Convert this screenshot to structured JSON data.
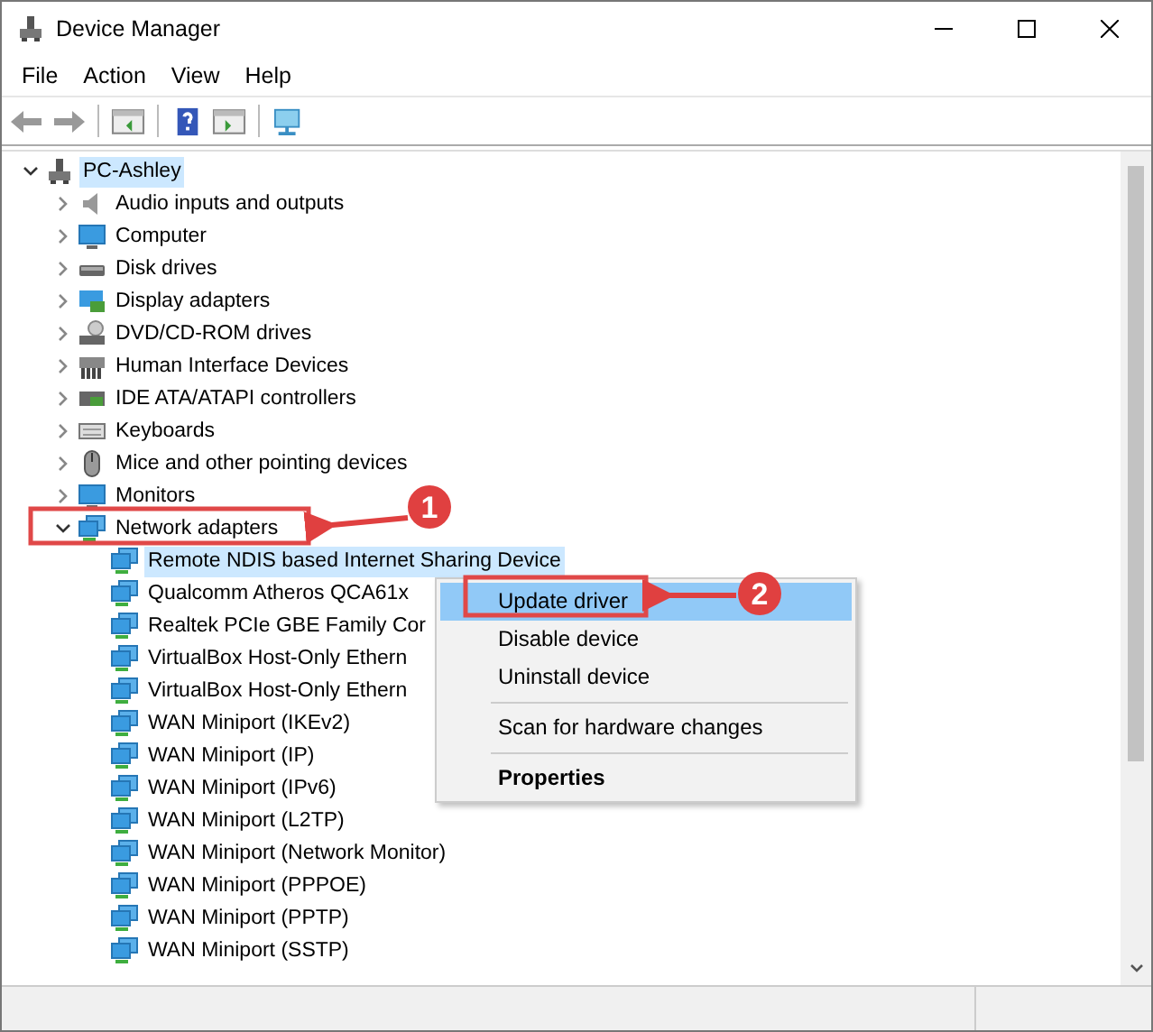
{
  "window": {
    "title": "Device Manager"
  },
  "menu_bar": [
    "File",
    "Action",
    "View",
    "Help"
  ],
  "tree": {
    "label": "PC-Ashley",
    "kind": "computer",
    "expanded": true,
    "selected": true,
    "children": [
      {
        "label": "Audio inputs and outputs",
        "kind": "audio",
        "expanded": false,
        "selected": false
      },
      {
        "label": "Computer",
        "kind": "monitor",
        "expanded": false,
        "selected": false
      },
      {
        "label": "Disk drives",
        "kind": "disk",
        "expanded": false,
        "selected": false
      },
      {
        "label": "Display adapters",
        "kind": "display",
        "expanded": false,
        "selected": false
      },
      {
        "label": "DVD/CD-ROM drives",
        "kind": "dvd",
        "expanded": false,
        "selected": false
      },
      {
        "label": "Human Interface Devices",
        "kind": "hid",
        "expanded": false,
        "selected": false
      },
      {
        "label": "IDE ATA/ATAPI controllers",
        "kind": "ide",
        "expanded": false,
        "selected": false
      },
      {
        "label": "Keyboards",
        "kind": "keyboard",
        "expanded": false,
        "selected": false
      },
      {
        "label": "Mice and other pointing devices",
        "kind": "mouse",
        "expanded": false,
        "selected": false
      },
      {
        "label": "Monitors",
        "kind": "monitor",
        "expanded": false,
        "selected": false
      },
      {
        "label": "Network adapters",
        "kind": "network",
        "expanded": true,
        "selected": false,
        "children": [
          {
            "label": "Remote NDIS based Internet Sharing Device",
            "kind": "network",
            "selected": true
          },
          {
            "label": "Qualcomm Atheros QCA61x",
            "kind": "network",
            "selected": false
          },
          {
            "label": "Realtek PCIe GBE Family Cor",
            "kind": "network",
            "selected": false
          },
          {
            "label": "VirtualBox Host-Only Ethern",
            "kind": "network",
            "selected": false
          },
          {
            "label": "VirtualBox Host-Only Ethern",
            "kind": "network",
            "selected": false
          },
          {
            "label": "WAN Miniport (IKEv2)",
            "kind": "network",
            "selected": false
          },
          {
            "label": "WAN Miniport (IP)",
            "kind": "network",
            "selected": false
          },
          {
            "label": "WAN Miniport (IPv6)",
            "kind": "network",
            "selected": false
          },
          {
            "label": "WAN Miniport (L2TP)",
            "kind": "network",
            "selected": false
          },
          {
            "label": "WAN Miniport (Network Monitor)",
            "kind": "network",
            "selected": false
          },
          {
            "label": "WAN Miniport (PPPOE)",
            "kind": "network",
            "selected": false
          },
          {
            "label": "WAN Miniport (PPTP)",
            "kind": "network",
            "selected": false
          },
          {
            "label": "WAN Miniport (SSTP)",
            "kind": "network",
            "selected": false
          }
        ]
      }
    ]
  },
  "context_menu": [
    {
      "label": "Update driver",
      "selected": true,
      "separator_before": false,
      "default": false
    },
    {
      "label": "Disable device",
      "selected": false,
      "separator_before": false,
      "default": false
    },
    {
      "label": "Uninstall device",
      "selected": false,
      "separator_before": false,
      "default": false
    },
    {
      "label": "Scan for hardware changes",
      "selected": false,
      "separator_before": true,
      "default": false
    },
    {
      "label": "Properties",
      "selected": false,
      "separator_before": true,
      "default": true
    }
  ],
  "annotations": [
    {
      "number": "1"
    },
    {
      "number": "2"
    }
  ]
}
